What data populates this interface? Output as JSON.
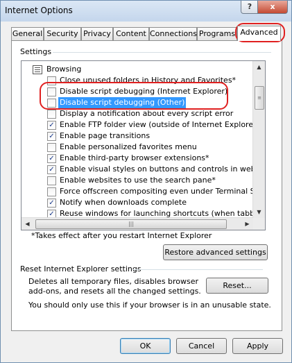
{
  "window": {
    "title": "Internet Options",
    "help_glyph": "?",
    "close_glyph": "x"
  },
  "tabs": [
    {
      "label": "General"
    },
    {
      "label": "Security"
    },
    {
      "label": "Privacy"
    },
    {
      "label": "Content"
    },
    {
      "label": "Connections"
    },
    {
      "label": "Programs"
    },
    {
      "label": "Advanced",
      "active": true
    }
  ],
  "settings": {
    "group_label": "Settings",
    "category": "Browsing",
    "items": [
      {
        "label": "Close unused folders in History and Favorites*",
        "checked": false
      },
      {
        "label": "Disable script debugging (Internet Explorer)",
        "checked": false
      },
      {
        "label": "Disable script debugging (Other)",
        "checked": false,
        "selected": true
      },
      {
        "label": "Display a notification about every script error",
        "checked": false
      },
      {
        "label": "Enable FTP folder view (outside of Internet Explorer)",
        "checked": true
      },
      {
        "label": "Enable page transitions",
        "checked": true
      },
      {
        "label": "Enable personalized favorites menu",
        "checked": false
      },
      {
        "label": "Enable third-party browser extensions*",
        "checked": true
      },
      {
        "label": "Enable visual styles on buttons and controls in webpages",
        "checked": true
      },
      {
        "label": "Enable websites to use the search pane*",
        "checked": false
      },
      {
        "label": "Force offscreen compositing even under Terminal Server*",
        "checked": false
      },
      {
        "label": "Notify when downloads complete",
        "checked": true
      },
      {
        "label": "Reuse windows for launching shortcuts (when tabbed brow",
        "checked": true
      }
    ],
    "note": "*Takes effect after you restart Internet Explorer",
    "restore_button": "Restore advanced settings"
  },
  "reset": {
    "group_label": "Reset Internet Explorer settings",
    "description_line1": "Deletes all temporary files, disables browser",
    "description_line2": "add-ons, and resets all the changed settings.",
    "reset_button": "Reset...",
    "warning": "You should only use this if your browser is in an unusable state."
  },
  "footer": {
    "ok": "OK",
    "cancel": "Cancel",
    "apply": "Apply"
  },
  "icons": {
    "up": "▲",
    "down": "▼",
    "left": "◀",
    "right": "▶",
    "check": "✓",
    "grip": "≡",
    "hgrip": "|||"
  },
  "colors": {
    "selection": "#3399ff",
    "highlight_ring": "#e02020"
  }
}
